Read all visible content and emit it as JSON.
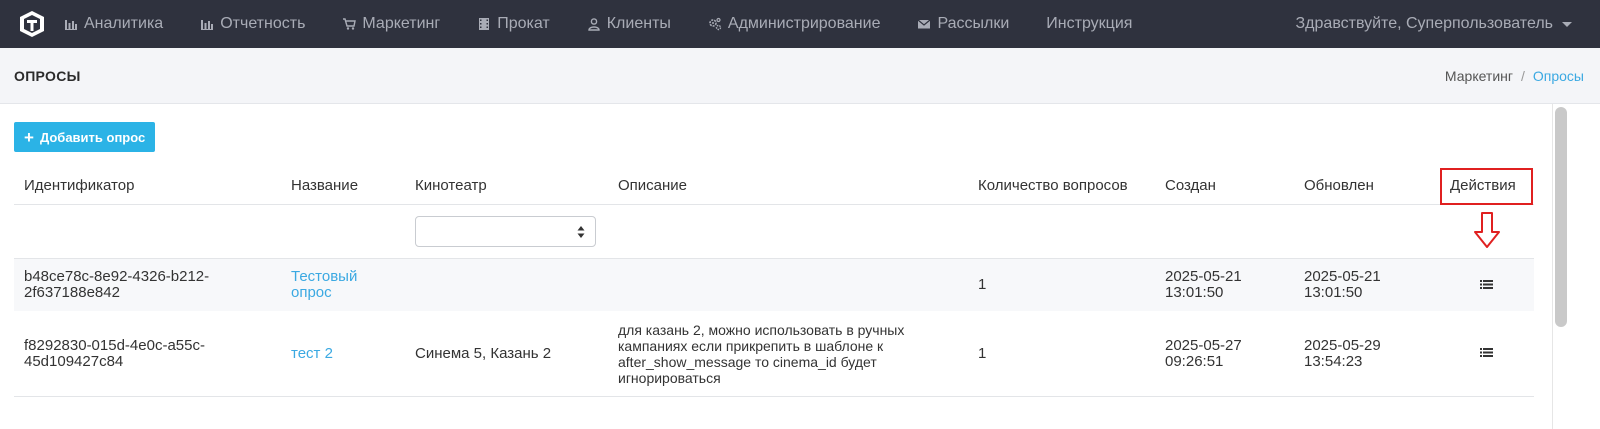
{
  "nav": {
    "items": [
      {
        "label": "Аналитика",
        "icon": "bar-chart-icon"
      },
      {
        "label": "Отчетность",
        "icon": "bar-chart-icon"
      },
      {
        "label": "Маркетинг",
        "icon": "cart-icon"
      },
      {
        "label": "Прокат",
        "icon": "film-icon"
      },
      {
        "label": "Клиенты",
        "icon": "user-icon"
      },
      {
        "label": "Администрирование",
        "icon": "cogs-icon"
      },
      {
        "label": "Рассылки",
        "icon": "envelope-icon"
      },
      {
        "label": "Инструкция",
        "icon": ""
      }
    ],
    "user_greeting": "Здравствуйте, Суперпользователь"
  },
  "page": {
    "title": "ОПРОСЫ",
    "breadcrumb": [
      "Маркетинг",
      "Опросы"
    ]
  },
  "add_button": {
    "label": "Добавить опрос"
  },
  "table": {
    "headers": [
      "Идентификатор",
      "Название",
      "Кинотеатр",
      "Описание",
      "Количество вопросов",
      "Создан",
      "Обновлен",
      "Действия"
    ],
    "rows": [
      {
        "id_line1": "b48ce78c-8e92-4326-b212-",
        "id_line2": "2f637188e842",
        "name_line1": "Тестовый",
        "name_line2": "опрос",
        "cinema": "",
        "description": [],
        "questions": "1",
        "created_date": "2025-05-21",
        "created_time": "13:01:50",
        "updated_date": "2025-05-21",
        "updated_time": "13:01:50"
      },
      {
        "id_line1": "f8292830-015d-4e0c-a55c-",
        "id_line2": "45d109427c84",
        "name_line1": "тест 2",
        "name_line2": "",
        "cinema": "Синема 5, Казань 2",
        "description": [
          "для казань 2, можно использовать в ручных",
          "кампаниях если прикрепить в шаблоне к",
          "after_show_message то cinema_id будет",
          "игнорироваться"
        ],
        "questions": "1",
        "created_date": "2025-05-27",
        "created_time": "09:26:51",
        "updated_date": "2025-05-29",
        "updated_time": "13:54:23"
      }
    ]
  },
  "colors": {
    "navbar": "#2f323e",
    "accent": "#2bb3e6",
    "link": "#3ba9e2",
    "annotation": "#e02020"
  }
}
